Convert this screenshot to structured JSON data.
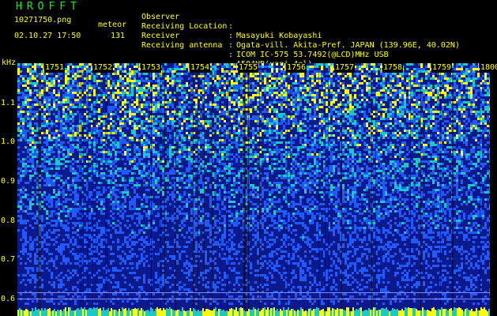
{
  "header": {
    "app_name": "HROFFT",
    "filename": "10271750.png",
    "datetime": "02.10.27 17:50",
    "meteor_label": "meteor",
    "meteor_count": "131"
  },
  "info": [
    {
      "label": "Observer",
      "value": "Masayuki Kobayashi"
    },
    {
      "label": "Receiving Location",
      "value": "Ogata-vill. Akita-Pref. JAPAN (139.96E, 40.02N)"
    },
    {
      "label": "Receiver",
      "value": "ICOM IC-575 53.7492(@LCD)MHz USB"
    },
    {
      "label": "Receiving antenna",
      "value": "A504HB(yagi 4el)"
    }
  ],
  "info_separator": ":",
  "spectrogram": {
    "y_unit": "kHz",
    "y_ticks": [
      "1.1",
      "1.0",
      "0.9",
      "0.8",
      "0.7",
      "0.6"
    ],
    "y_tick_values": [
      1.1,
      1.0,
      0.9,
      0.8,
      0.7,
      0.6
    ],
    "time_ticks": [
      "1751",
      "1752",
      "1753",
      "1754",
      "1755",
      "1756",
      "1757",
      "1758",
      "1759",
      "1800"
    ],
    "colors": {
      "background": "#000000",
      "text": "#ffff00",
      "title": "#00ff00",
      "noise_low": "#0a1a8c",
      "noise_mid": "#1e5aff",
      "noise_high": "#19c8c8",
      "noise_peak": "#ffff00"
    }
  }
}
